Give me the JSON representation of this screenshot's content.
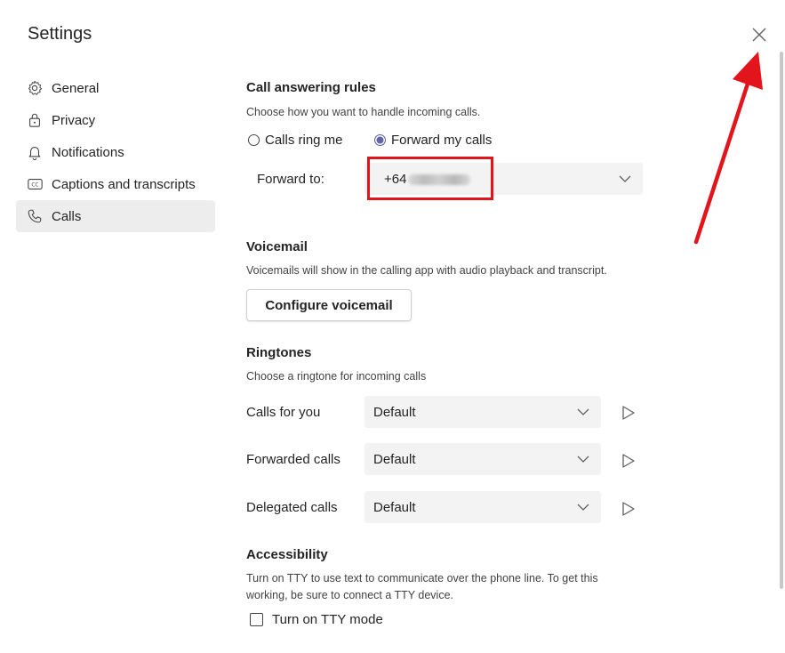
{
  "window": {
    "title": "Settings"
  },
  "nav": {
    "items": [
      {
        "label": "General",
        "icon": "gear-icon"
      },
      {
        "label": "Privacy",
        "icon": "lock-icon"
      },
      {
        "label": "Notifications",
        "icon": "bell-icon"
      },
      {
        "label": "Captions and transcripts",
        "icon": "cc-icon"
      },
      {
        "label": "Calls",
        "icon": "phone-icon",
        "active": true
      }
    ]
  },
  "call_answering": {
    "title": "Call answering rules",
    "description": "Choose how you want to handle incoming calls.",
    "options": [
      {
        "label": "Calls ring me",
        "selected": false
      },
      {
        "label": "Forward my calls",
        "selected": true
      }
    ],
    "forward_label": "Forward to:",
    "forward_value": "+64"
  },
  "voicemail": {
    "title": "Voicemail",
    "description": "Voicemails will show in the calling app with audio playback and transcript.",
    "button_label": "Configure voicemail"
  },
  "ringtones": {
    "title": "Ringtones",
    "description": "Choose a ringtone for incoming calls",
    "rows": [
      {
        "label": "Calls for you",
        "value": "Default"
      },
      {
        "label": "Forwarded calls",
        "value": "Default"
      },
      {
        "label": "Delegated calls",
        "value": "Default"
      }
    ]
  },
  "accessibility": {
    "title": "Accessibility",
    "description_line1": "Turn on TTY to use text to communicate over the phone line. To get this",
    "description_line2": "working, be sure to connect a TTY device.",
    "checkbox_label": "Turn on TTY mode",
    "checked": false
  },
  "colors": {
    "accent": "#6264a7",
    "annotation": "#e3151c",
    "active_nav": "#ededed",
    "select_bg": "#f3f3f3"
  }
}
